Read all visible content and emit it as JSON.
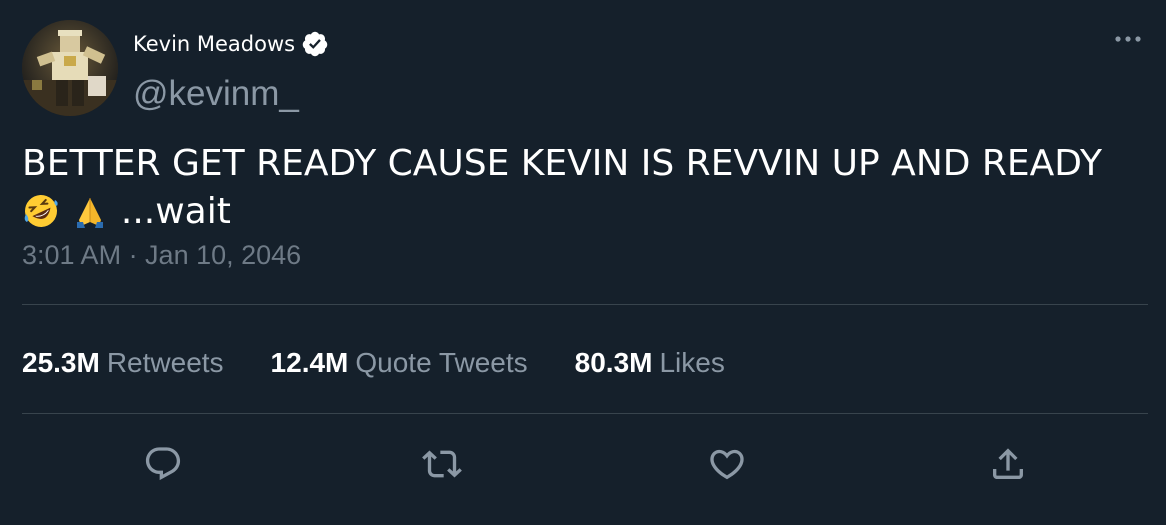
{
  "author": {
    "display_name": "Kevin Meadows",
    "handle": "@kevinm_",
    "verified": true,
    "avatar_icon": "avatar-image"
  },
  "menu": {
    "more_icon": "more-horizontal-icon"
  },
  "tweet": {
    "text_main": "BETTER GET READY CAUSE KEVIN IS REVVIN UP AND READY",
    "emojis": [
      "rofl-emoji-icon",
      "folded-hands-emoji-icon"
    ],
    "text_tail": " ...wait",
    "timestamp": "3:01 AM · Jan 10, 2046"
  },
  "stats": [
    {
      "count": "25.3M",
      "label": "Retweets"
    },
    {
      "count": "12.4M",
      "label": "Quote Tweets"
    },
    {
      "count": "80.3M",
      "label": "Likes"
    }
  ],
  "actions": [
    {
      "icon": "reply-icon"
    },
    {
      "icon": "retweet-icon"
    },
    {
      "icon": "like-icon"
    },
    {
      "icon": "share-icon"
    }
  ],
  "colors": {
    "background": "#15202b",
    "text_primary": "#ffffff",
    "text_secondary": "#8b98a5",
    "divider": "#38444d",
    "verified_badge": "#ffffff"
  }
}
